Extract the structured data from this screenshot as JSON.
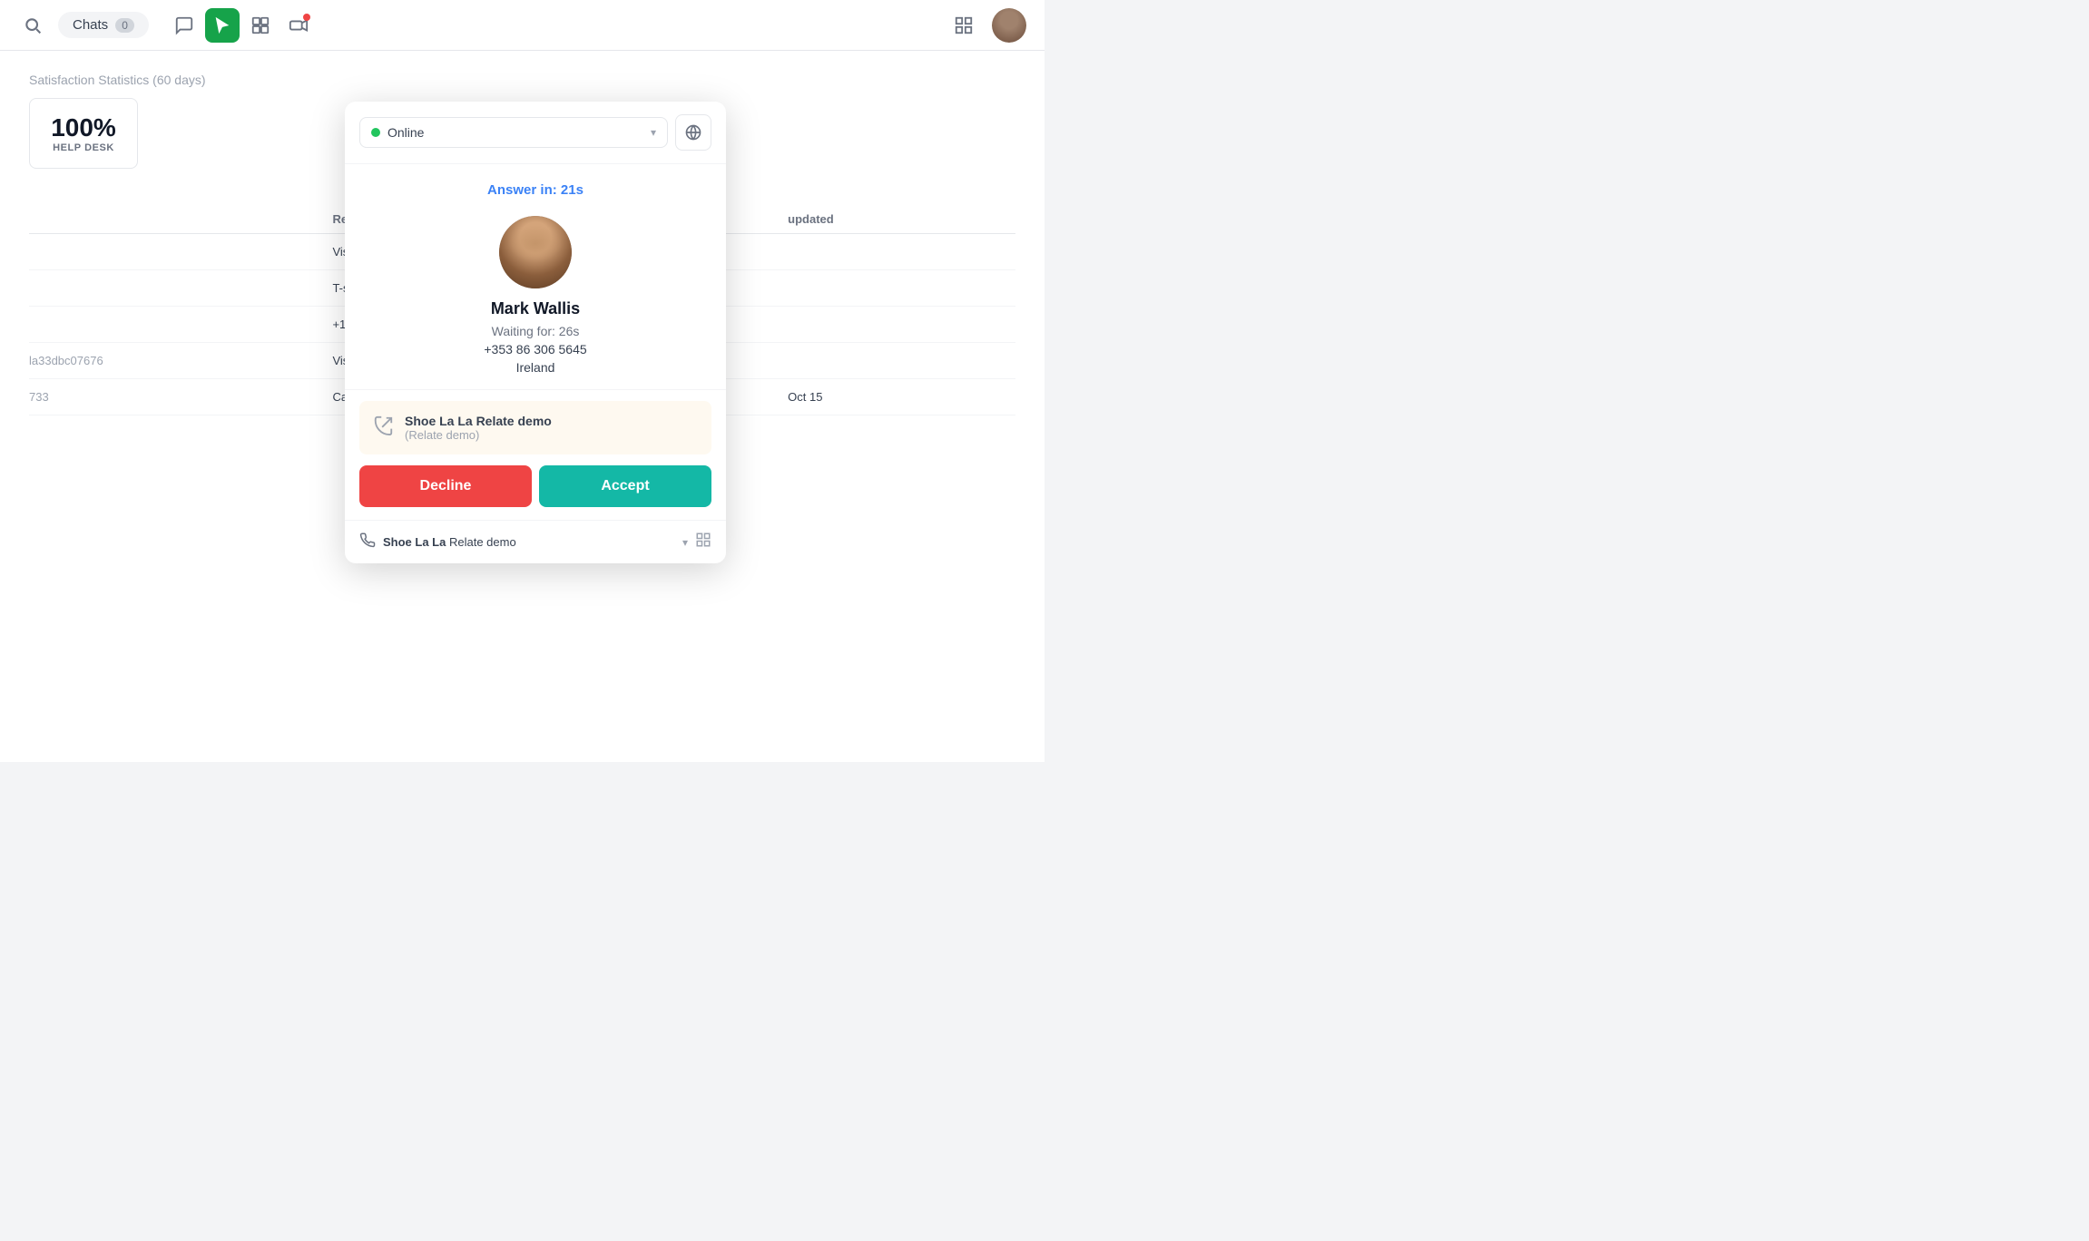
{
  "topbar": {
    "chats_label": "Chats",
    "chats_count": "0",
    "icons": [
      {
        "name": "chat-icon",
        "label": "Chat"
      },
      {
        "name": "cursor-icon",
        "label": "Cursor",
        "active": true
      },
      {
        "name": "dashboard-icon",
        "label": "Dashboard"
      },
      {
        "name": "broadcast-icon",
        "label": "Broadcast"
      }
    ],
    "grid_icon": "Grid",
    "avatar_alt": "User avatar"
  },
  "background": {
    "stat_title": "Satisfaction Statistics",
    "stat_period": "(60 days)",
    "stat_percent": "100%",
    "stat_sublabel": "HELP DESK",
    "table_headers": [
      "",
      "Requester",
      "",
      "updated"
    ],
    "table_rows": [
      {
        "col1": "",
        "requester": "Visitor 36162349",
        "col3": "",
        "updated": ""
      },
      {
        "col1": "",
        "requester": "T-shirts bootcamp",
        "col3": "",
        "updated": ""
      },
      {
        "col1": "",
        "requester": "+1 (318) 581-4202",
        "col3": "",
        "updated": ""
      },
      {
        "col1": "la33dbc07676",
        "requester": "Visitor 964dadb3ab",
        "col3": "",
        "updated": ""
      },
      {
        "col1": "733",
        "requester": "Caller +1 (3) 457-7733",
        "col3": "",
        "updated": "Oct 15"
      }
    ]
  },
  "popup": {
    "status": {
      "label": "Online",
      "dot_color": "#22c55e"
    },
    "answer_in_label": "Answer in:",
    "answer_in_value": "21s",
    "caller": {
      "name": "Mark Wallis",
      "waiting_label": "Waiting for:",
      "waiting_value": "26s",
      "phone": "+353 86 306 5645",
      "country": "Ireland"
    },
    "call_info": {
      "title": "Shoe La La Relate demo",
      "subtitle": "(Relate demo)"
    },
    "decline_label": "Decline",
    "accept_label": "Accept",
    "bottom_bar": {
      "brand": "Shoe La La",
      "subtitle": "Relate demo"
    }
  }
}
